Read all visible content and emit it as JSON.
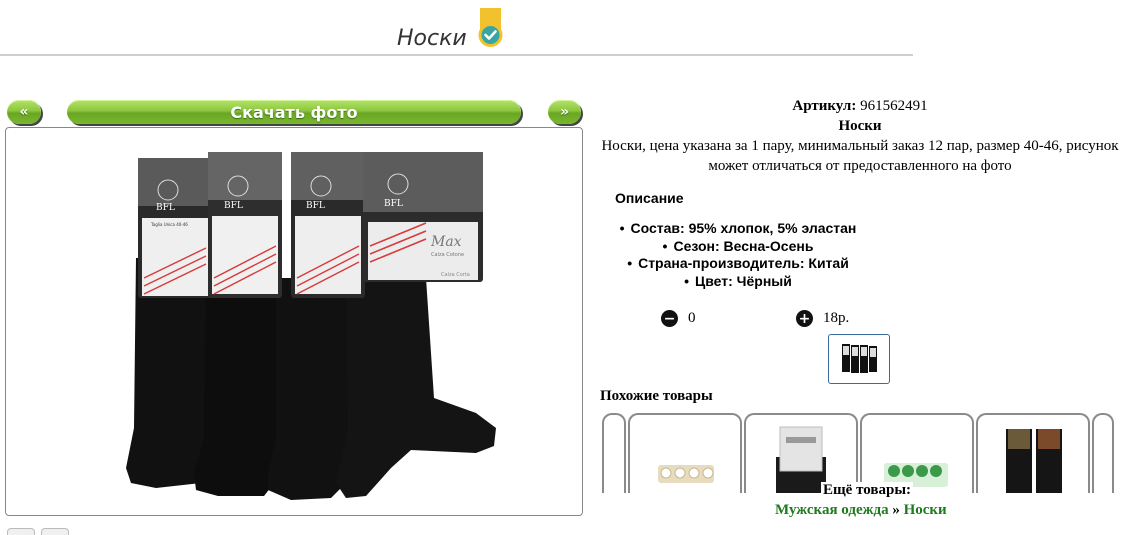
{
  "header": {
    "title": "Носки"
  },
  "nav": {
    "prev_label": "«",
    "download_label": "Скачать фото",
    "next_label": "»"
  },
  "product": {
    "article_label": "Артикул:",
    "article_value": "961562491",
    "name": "Носки",
    "summary": "Носки, цена указана за 1 пару, минимальный заказ 12 пар, размер 40-46, рисунок может отличаться от предоставленного на фото",
    "description_heading": "Описание",
    "specs": [
      "Состав: 95% хлопок, 5% эластан",
      "Сезон: Весна-Осень",
      "Страна-производитель: Китай",
      "Цвет: Чёрный"
    ],
    "quantity": "0",
    "price": "18р."
  },
  "photo": {
    "brand": "BFL",
    "tag_text": "Taglia Unica 40-46",
    "max_label": "Max",
    "max_sub": "Calza Cotone",
    "calza_label": "Calza Corta"
  },
  "similar": {
    "heading": "Похожие товары"
  },
  "more": {
    "heading": "Ещё товары:",
    "breadcrumb": [
      "Мужская одежда",
      "Носки"
    ],
    "separator": "»"
  },
  "colors": {
    "accent_green": "#8cc63f",
    "link_green": "#1e7a1e",
    "badge_yellow": "#f2c12e",
    "badge_teal": "#3aa5a0"
  }
}
